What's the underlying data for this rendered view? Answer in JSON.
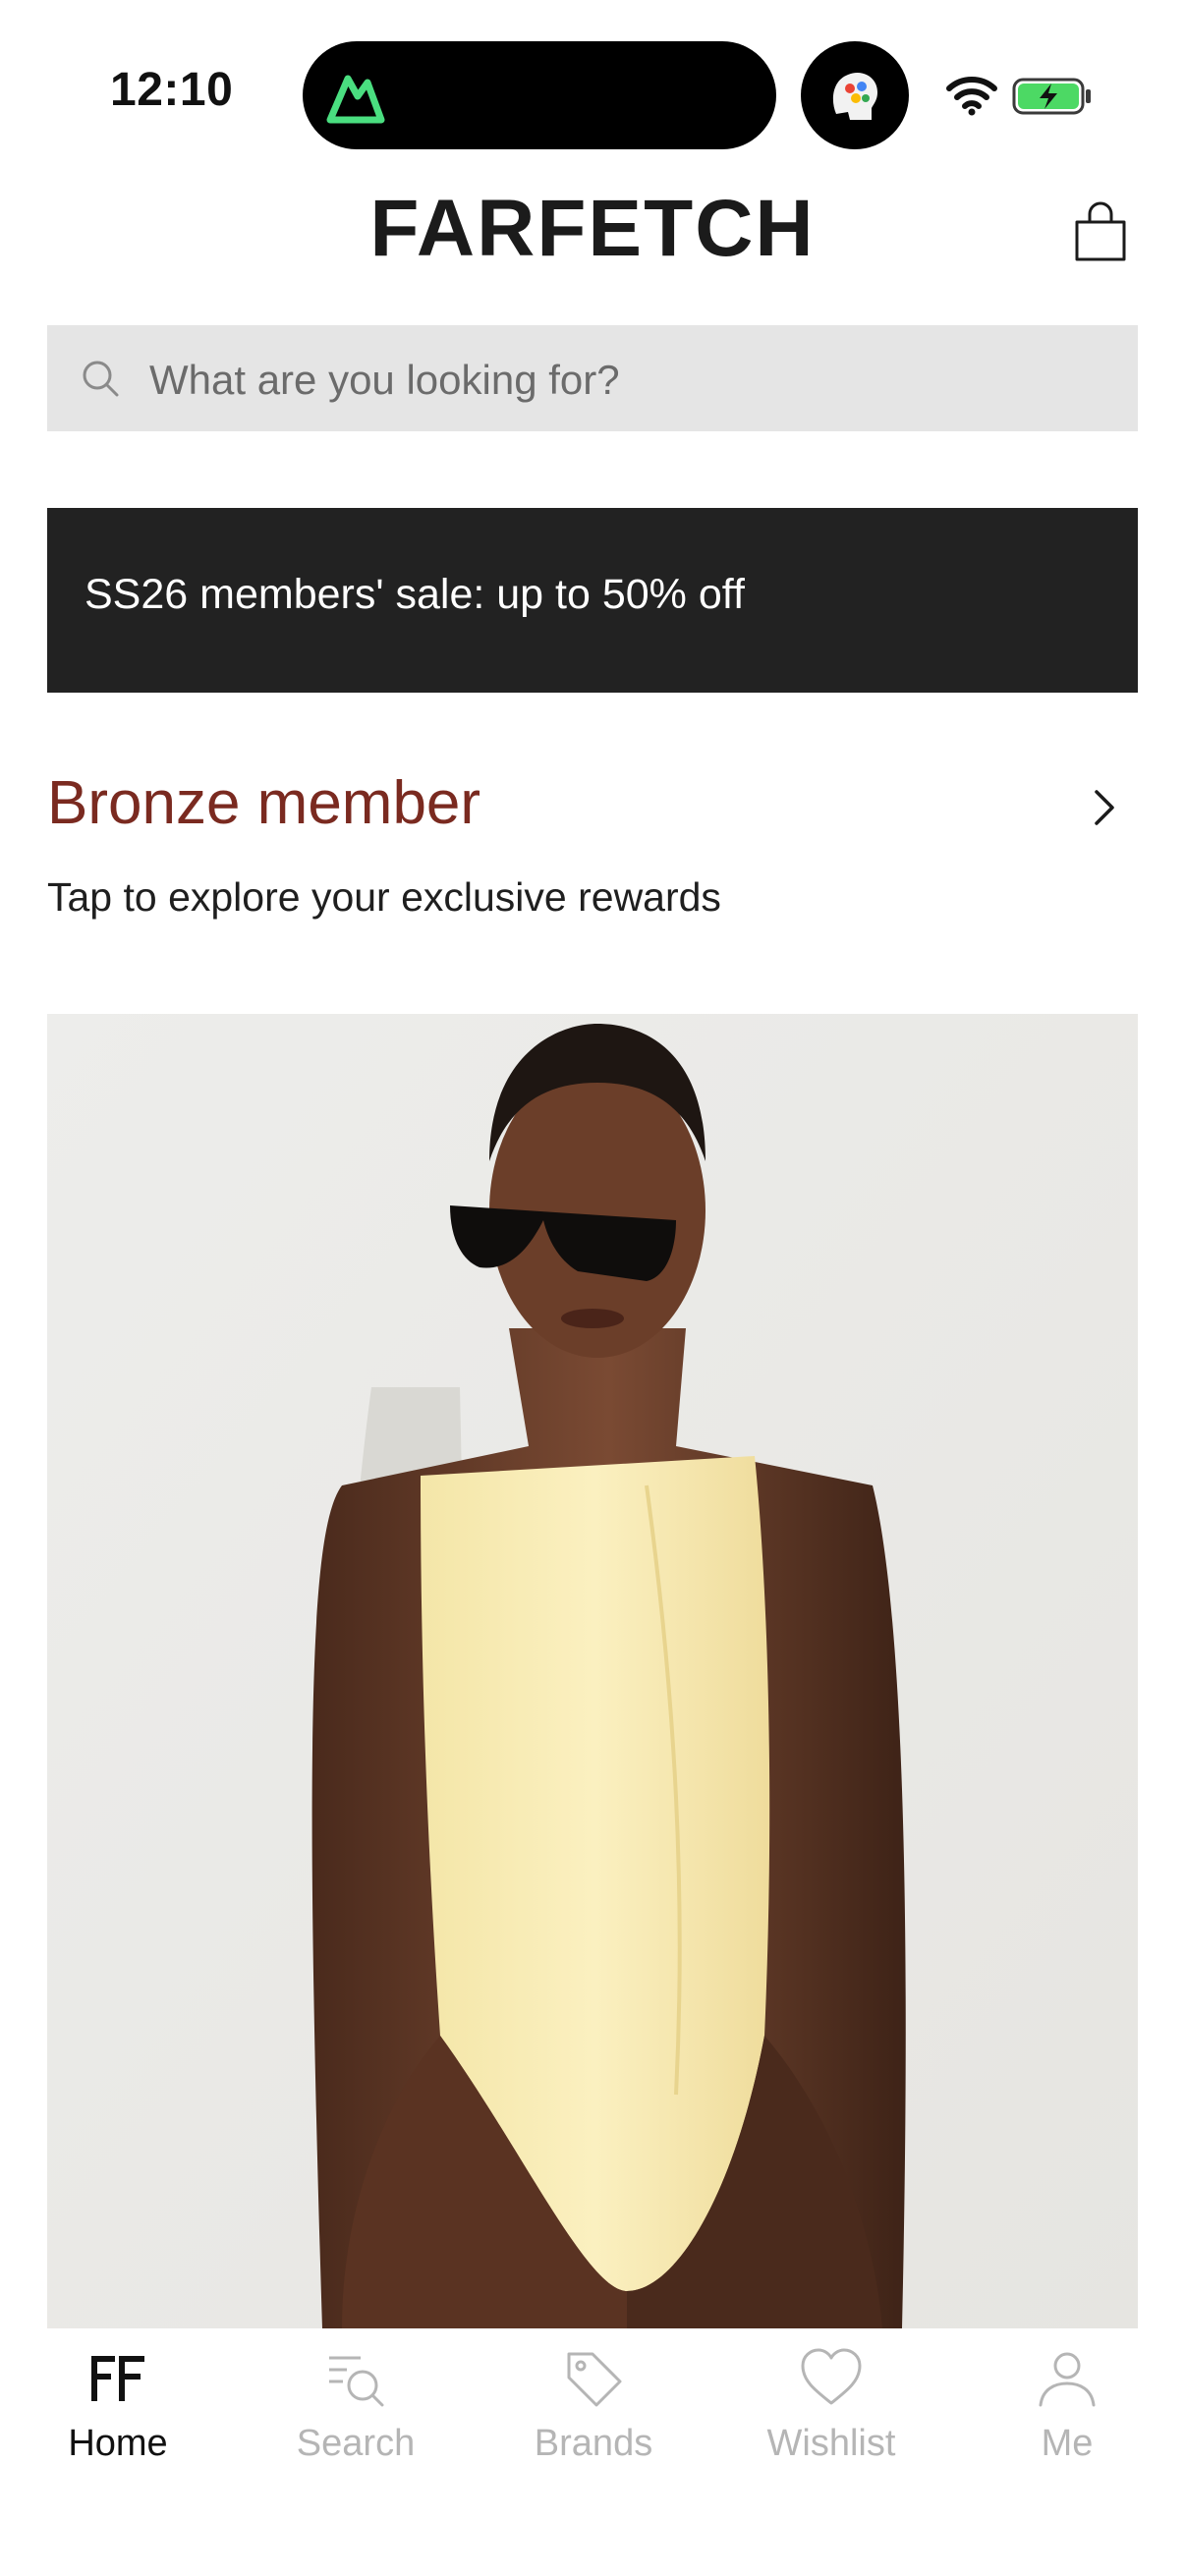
{
  "status_bar": {
    "time": "12:10",
    "icons": [
      "app-activity-icon",
      "app-avatar-icon",
      "wifi-icon",
      "battery-charging-icon"
    ],
    "battery_color": "#4cd964"
  },
  "header": {
    "logo": "FARFETCH",
    "bag_icon": "shopping-bag-icon"
  },
  "search": {
    "placeholder": "What are you looking for?",
    "icon": "search-icon"
  },
  "promo_banner": {
    "text": "SS26 members' sale: up to 50% off",
    "background": "#222222"
  },
  "membership": {
    "tier": "Bronze member",
    "subtitle": "Tap to explore your exclusive rewards",
    "tier_color": "#7a2a20"
  },
  "hero": {
    "image": "model-yellow-swimsuit-photo"
  },
  "bottom_nav": {
    "items": [
      {
        "label": "Home",
        "icon": "farfetch-home-icon",
        "active": true
      },
      {
        "label": "Search",
        "icon": "search-list-icon",
        "active": false
      },
      {
        "label": "Brands",
        "icon": "tag-icon",
        "active": false
      },
      {
        "label": "Wishlist",
        "icon": "heart-icon",
        "active": false
      },
      {
        "label": "Me",
        "icon": "person-icon",
        "active": false
      }
    ]
  }
}
